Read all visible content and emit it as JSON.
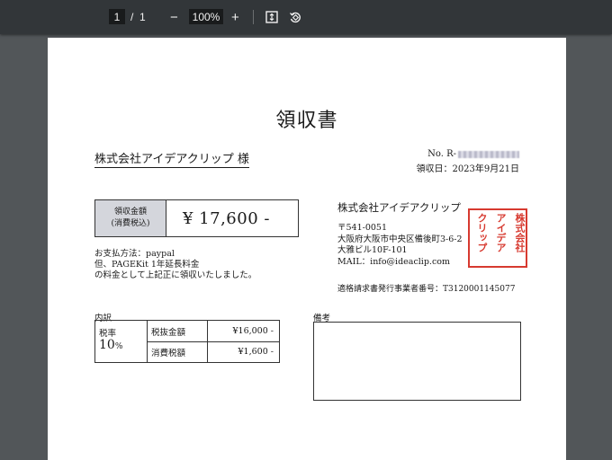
{
  "toolbar": {
    "page_current": "1",
    "page_separator": "/",
    "page_total": "1",
    "zoom_out_glyph": "−",
    "zoom_level": "100%",
    "zoom_in_glyph": "+",
    "fit_icon": "fit-page-icon",
    "rotate_icon": "rotate-icon"
  },
  "receipt": {
    "title": "領収書",
    "recipient": "株式会社アイデアクリップ 様",
    "no_label": "No. R-",
    "issue_date": "領収日：2023年9月21日",
    "amount_label_line1": "領収金額",
    "amount_label_line2": "(消費税込)",
    "amount": "¥ 17,600 -",
    "pay_line1": "お支払方法：paypal",
    "pay_line2": "但、PAGEKit 1年延長料金",
    "pay_line3": "の料金として上記正に領収いたしました。",
    "company_name": "株式会社アイデアクリップ",
    "postal": "〒541-0051",
    "address1": "大阪府大阪市中央区備後町3-6-2",
    "address2": "大雅ビル10F-101",
    "mail": "MAIL：info@ideaclip.com",
    "invoice_reg": "適格請求書発行事業者番号：T3120001145077",
    "stamp_text": [
      "株式会社",
      "アイデア",
      "クリップ"
    ],
    "stamp_color": "#d73a30",
    "breakdown_label": "内訳",
    "tax_rate_label": "税率",
    "tax_rate_value": "10",
    "tax_rate_unit": "%",
    "row1_label": "税抜金額",
    "row1_value": "¥16,000 -",
    "row2_label": "消費税額",
    "row2_value": "¥1,600 -",
    "remarks_label": "備考"
  }
}
